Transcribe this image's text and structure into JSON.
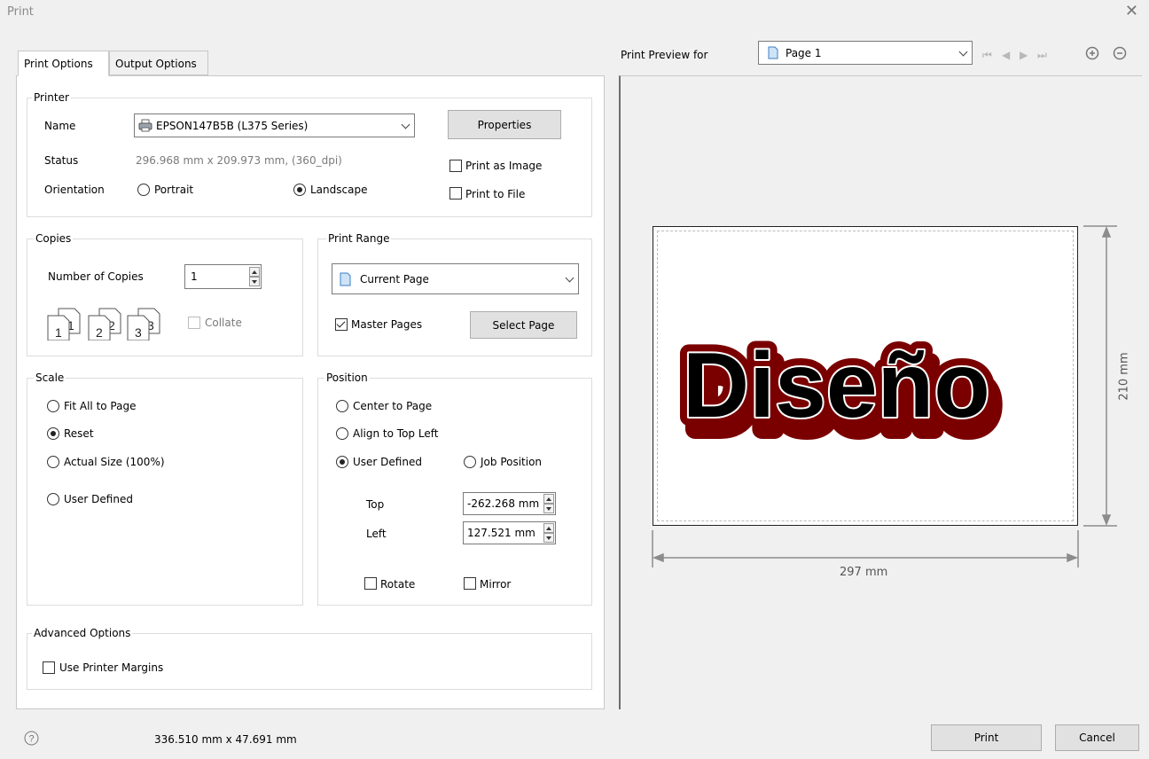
{
  "window": {
    "title": "Print"
  },
  "tabs": [
    {
      "label": "Print Options",
      "active": true
    },
    {
      "label": "Output Options",
      "active": false
    }
  ],
  "printer": {
    "group_label": "Printer",
    "name_label": "Name",
    "name_value": "EPSON147B5B (L375 Series)",
    "status_label": "Status",
    "status_value": "296.968 mm x 209.973 mm, (360_dpi)",
    "orientation_label": "Orientation",
    "portrait_label": "Portrait",
    "landscape_label": "Landscape",
    "orientation_selected": "Landscape",
    "properties_label": "Properties",
    "print_as_image_label": "Print as Image",
    "print_as_image_checked": false,
    "print_to_file_label": "Print to File",
    "print_to_file_checked": false
  },
  "copies": {
    "group_label": "Copies",
    "number_label": "Number of Copies",
    "number_value": "1",
    "collate_label": "Collate",
    "collate_checked": false,
    "collate_enabled": false,
    "collate_icon": "collate-pages-icon"
  },
  "print_range": {
    "group_label": "Print Range",
    "selected": "Current Page",
    "master_pages_label": "Master Pages",
    "master_pages_checked": true,
    "select_page_label": "Select Page"
  },
  "scale": {
    "group_label": "Scale",
    "options": [
      "Fit All to Page",
      "Reset",
      "Actual Size (100%)",
      "User Defined"
    ],
    "selected": "Reset"
  },
  "position": {
    "group_label": "Position",
    "center_label": "Center to Page",
    "align_label": "Align to Top Left",
    "user_defined_label": "User Defined",
    "job_position_label": "Job Position",
    "selected": "User Defined",
    "top_label": "Top",
    "top_value": "-262.268 mm",
    "left_label": "Left",
    "left_value": "127.521 mm",
    "rotate_label": "Rotate",
    "rotate_checked": false,
    "mirror_label": "Mirror",
    "mirror_checked": false
  },
  "advanced": {
    "group_label": "Advanced Options",
    "use_margins_label": "Use Printer Margins",
    "use_margins_checked": false
  },
  "preview": {
    "label": "Print Preview for",
    "page_selected": "Page 1",
    "artwork_text": "Diseño",
    "width_label": "297 mm",
    "height_label": "210 mm",
    "artwork_fill": "#000000",
    "artwork_shadow": "#7a0000"
  },
  "footer": {
    "job_size": "336.510 mm x 47.691 mm",
    "print_label": "Print",
    "cancel_label": "Cancel"
  }
}
